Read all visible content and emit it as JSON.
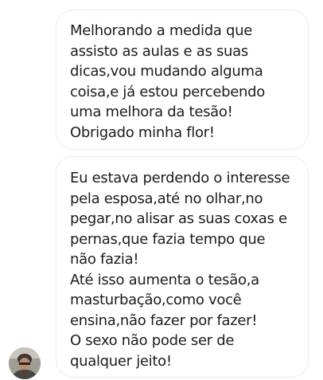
{
  "messages": [
    {
      "text": "Melhorando a medida que\nassisto as aulas e as suas\ndicas,vou mudando alguma\ncoisa,e já estou percebendo\numa melhora da tesão!\nObrigado minha flor!"
    },
    {
      "text": "Eu estava perdendo o interesse\npela esposa,até no olhar,no\npegar,no alisar as suas coxas e\npernas,que fazia tempo que\nnão fazia!\nAté isso aumenta o tesão,a\nmasturbação,como você\nensina,não fazer por fazer!\nO sexo não pode ser de\nqualquer jeito!"
    }
  ],
  "sender": {
    "avatar_icon": "user-avatar-photo"
  },
  "colors": {
    "background": "#ffffff",
    "bubble_border": "#ececec",
    "text": "#1c1c1c"
  }
}
